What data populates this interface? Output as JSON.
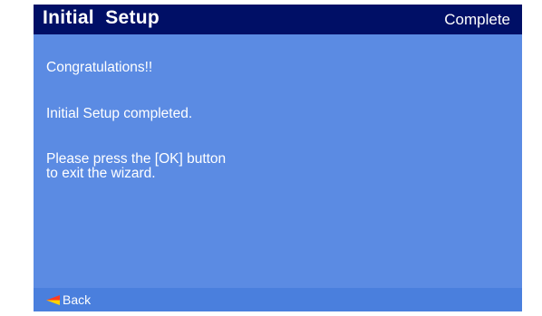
{
  "header": {
    "title": "Initial  Setup",
    "status": "Complete"
  },
  "content": {
    "line1": "Congratulations!!",
    "line2": "Initial Setup completed.",
    "line3a": "Please press the [OK] button",
    "line3b": "to exit the wizard."
  },
  "footer": {
    "back_label": "Back"
  },
  "colors": {
    "header_bg": "#000f66",
    "screen_bg": "#5b8be3",
    "footer_bg": "#4a7fdd",
    "back_arrow_top": "#ff3b1f",
    "back_arrow_bottom": "#ffd200"
  },
  "icons": {
    "back": "back-arrow-icon"
  }
}
